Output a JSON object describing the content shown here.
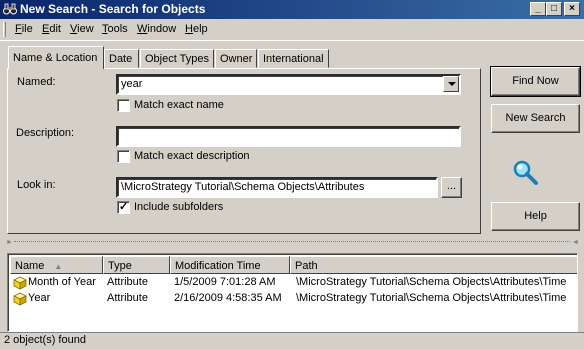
{
  "window": {
    "title": "New Search - Search for Objects",
    "controls": {
      "minimize": "_",
      "restore": "□",
      "close": "×"
    }
  },
  "menu": {
    "items": [
      {
        "label": "File",
        "mnemonic": "F"
      },
      {
        "label": "Edit",
        "mnemonic": "E"
      },
      {
        "label": "View",
        "mnemonic": "V"
      },
      {
        "label": "Tools",
        "mnemonic": "T"
      },
      {
        "label": "Window",
        "mnemonic": "W"
      },
      {
        "label": "Help",
        "mnemonic": "H"
      }
    ]
  },
  "tabs": {
    "items": [
      {
        "label": "Name & Location",
        "active": true
      },
      {
        "label": "Date",
        "active": false
      },
      {
        "label": "Object Types",
        "active": false
      },
      {
        "label": "Owner",
        "active": false
      },
      {
        "label": "International",
        "active": false
      }
    ]
  },
  "form": {
    "named_label": "Named:",
    "named_value": "year",
    "match_exact_name_label": "Match exact name",
    "match_exact_name_checked": false,
    "description_label": "Description:",
    "description_value": "",
    "match_exact_description_label": "Match exact description",
    "match_exact_description_checked": false,
    "look_in_label": "Look in:",
    "look_in_value": "\\MicroStrategy Tutorial\\Schema Objects\\Attributes",
    "browse_label": "...",
    "include_subfolders_label": "Include subfolders",
    "include_subfolders_checked": true
  },
  "actions": {
    "find_now": "Find Now",
    "new_search": "New Search",
    "help": "Help"
  },
  "results": {
    "columns": [
      "Name",
      "Type",
      "Modification Time",
      "Path"
    ],
    "rows": [
      {
        "name": "Month of Year",
        "type": "Attribute",
        "modified": "1/5/2009 7:01:28 AM",
        "path": "\\MicroStrategy Tutorial\\Schema Objects\\Attributes\\Time"
      },
      {
        "name": "Year",
        "type": "Attribute",
        "modified": "2/16/2009 4:58:35 AM",
        "path": "\\MicroStrategy Tutorial\\Schema Objects\\Attributes\\Time"
      }
    ]
  },
  "status": {
    "text": "2 object(s) found"
  },
  "colors": {
    "titlebar_start": "#0a246a",
    "titlebar_end": "#3a6ea5",
    "face": "#d4d0c8",
    "cube": "#f2d318"
  }
}
